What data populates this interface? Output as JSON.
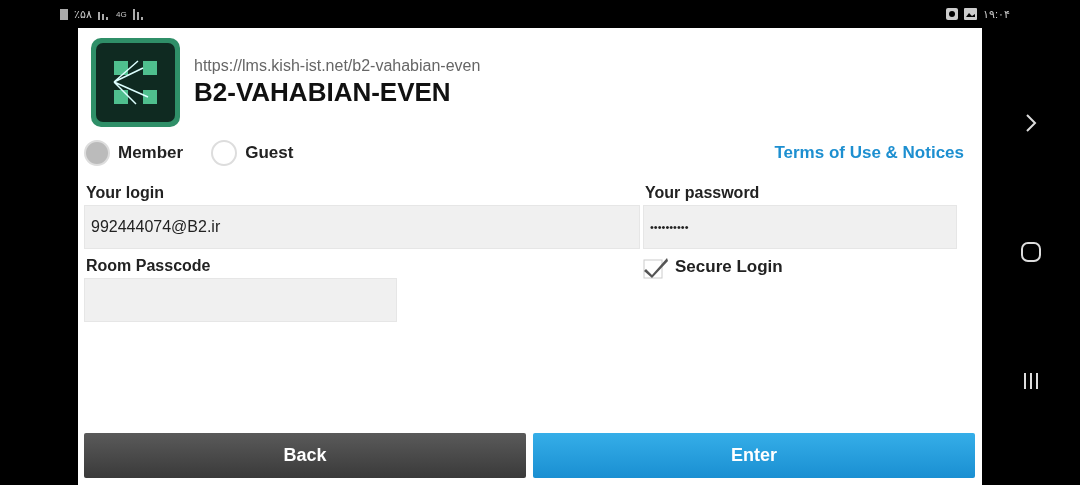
{
  "status_bar": {
    "battery": "٪۵۸",
    "network": "4G",
    "time": "۱۹:۰۴"
  },
  "header": {
    "url": "https://lms.kish-ist.net/b2-vahabian-even",
    "title": "B2-VAHABIAN-EVEN"
  },
  "login_type": [
    {
      "label": "Member",
      "selected": true
    },
    {
      "label": "Guest",
      "selected": false
    }
  ],
  "terms_link": "Terms of Use & Notices",
  "login": {
    "label": "Your login",
    "value": "992444074@B2.ir"
  },
  "password": {
    "label": "Your password",
    "value": "••••••••••"
  },
  "passcode": {
    "label": "Room Passcode"
  },
  "secure_login": {
    "label": "Secure Login",
    "checked": true
  },
  "buttons": [
    {
      "label": "Back",
      "kind": "secondary"
    },
    {
      "label": "Enter",
      "kind": "primary"
    }
  ]
}
